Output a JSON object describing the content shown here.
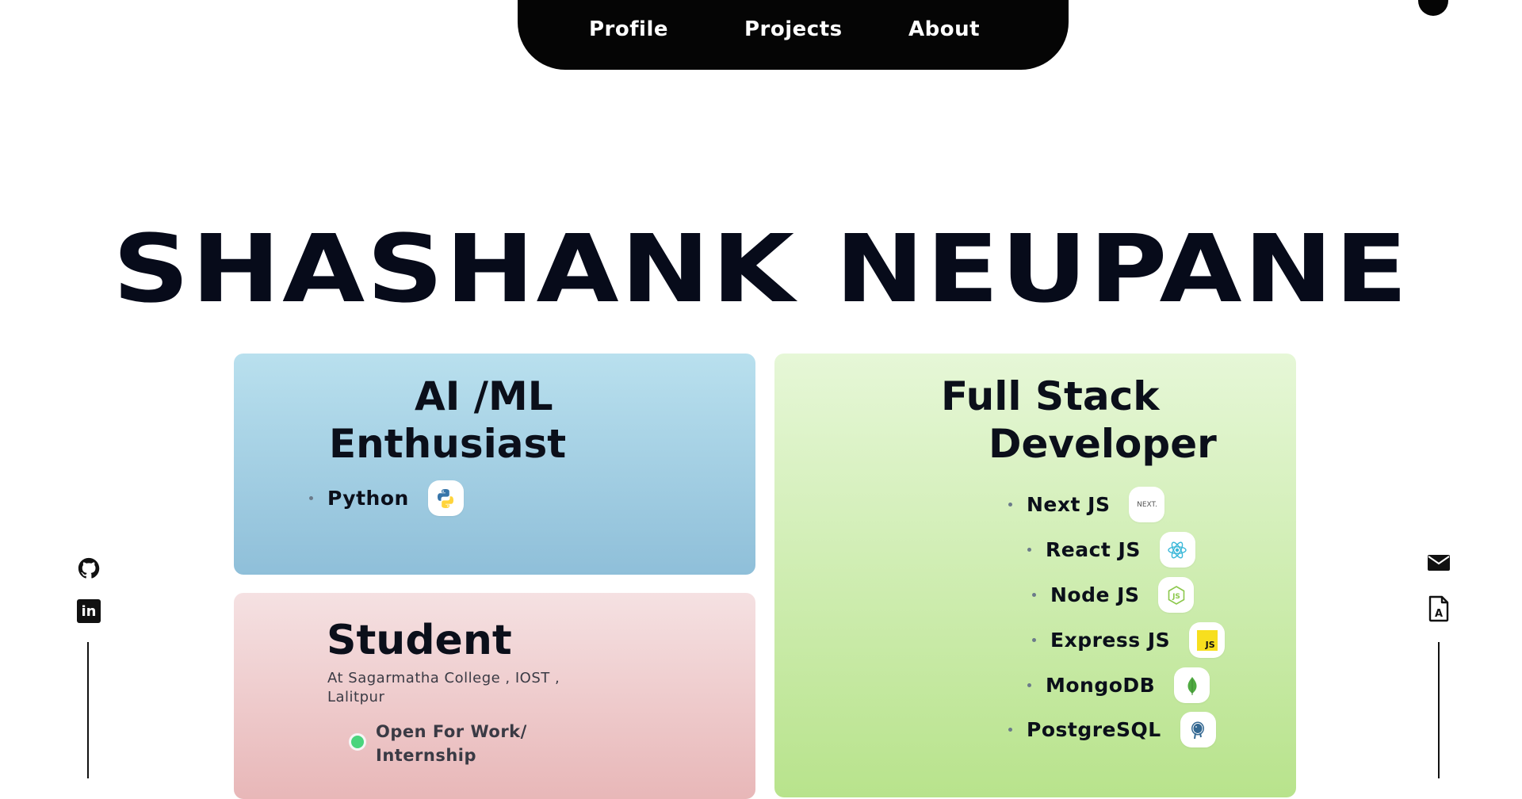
{
  "nav": {
    "items": [
      {
        "label": "Profile"
      },
      {
        "label": "Projects"
      },
      {
        "label": "About"
      }
    ]
  },
  "hero": {
    "name": "SHASHANK NEUPANE"
  },
  "cards": {
    "ai": {
      "title_line1": "AI /ML",
      "title_line2": "Enthusiast",
      "skills": [
        {
          "label": "Python",
          "icon": "python-icon"
        }
      ]
    },
    "student": {
      "title": "Student",
      "subtitle": "At Sagarmatha College , IOST , Lalitpur",
      "status": "Open For Work/ Internship",
      "status_color": "#4ad47d"
    },
    "fullstack": {
      "title_line1": "Full Stack",
      "title_line2": "Developer",
      "skills": [
        {
          "label": "Next JS",
          "icon": "nextjs-icon",
          "icon_text": "NEXT."
        },
        {
          "label": "React JS",
          "icon": "react-icon"
        },
        {
          "label": "Node JS",
          "icon": "nodejs-icon",
          "icon_text": "JS"
        },
        {
          "label": "Express JS",
          "icon": "expressjs-icon",
          "icon_text": "JS"
        },
        {
          "label": "MongoDB",
          "icon": "mongodb-icon"
        },
        {
          "label": "PostgreSQL",
          "icon": "postgresql-icon"
        }
      ]
    }
  },
  "social_left": [
    {
      "icon": "github-icon"
    },
    {
      "icon": "linkedin-icon",
      "icon_text": "in"
    }
  ],
  "social_right": [
    {
      "icon": "email-icon"
    },
    {
      "icon": "resume-icon",
      "icon_text": "A"
    }
  ],
  "colors": {
    "nav_bg": "#050505",
    "ai_card": "#b9e0ee",
    "student_card": "#f5e1e2",
    "fullstack_card": "#e6f7d7"
  }
}
